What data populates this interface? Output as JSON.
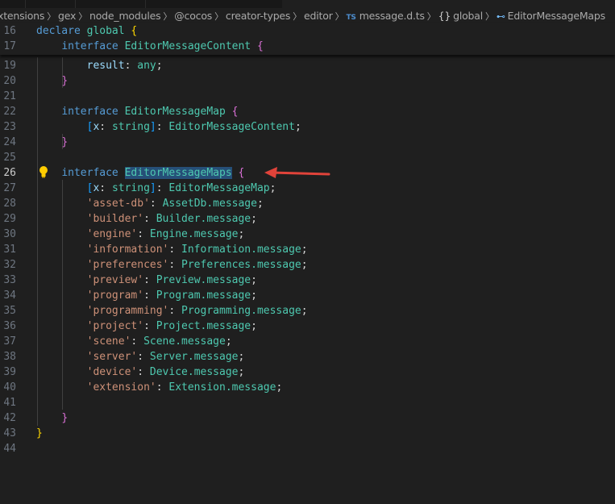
{
  "breadcrumb": {
    "items": [
      "xtensions",
      "gex",
      "node_modules",
      "@cocos",
      "creator-types",
      "editor"
    ],
    "file_icon": "TS",
    "file": "message.d.ts",
    "namespace_icon": "{}",
    "namespace": "global",
    "symbol_icon": "interface-symbol-icon",
    "symbol": "EditorMessageMaps"
  },
  "editor": {
    "active_line": 26,
    "sticky_lines": [
      {
        "n": "16",
        "tokens": [
          [
            "kw",
            "declare"
          ],
          [
            "pu",
            " "
          ],
          [
            "ty",
            "global"
          ],
          [
            "pu",
            " "
          ],
          [
            "b1",
            "{"
          ]
        ]
      },
      {
        "n": "17",
        "tokens": [
          [
            "pu",
            "    "
          ],
          [
            "kw",
            "interface"
          ],
          [
            "pu",
            " "
          ],
          [
            "ty",
            "EditorMessageContent"
          ],
          [
            "pu",
            " "
          ],
          [
            "b2",
            "{"
          ]
        ]
      }
    ],
    "lines": [
      {
        "n": "19",
        "tokens": [
          [
            "pu",
            "        "
          ],
          [
            "pr",
            "result"
          ],
          [
            "pu",
            ": "
          ],
          [
            "ty",
            "any"
          ],
          [
            "pu",
            ";"
          ]
        ]
      },
      {
        "n": "20",
        "tokens": [
          [
            "pu",
            "    "
          ],
          [
            "b2",
            "}"
          ]
        ]
      },
      {
        "n": "21",
        "tokens": []
      },
      {
        "n": "22",
        "tokens": [
          [
            "pu",
            "    "
          ],
          [
            "kw",
            "interface"
          ],
          [
            "pu",
            " "
          ],
          [
            "ty",
            "EditorMessageMap"
          ],
          [
            "pu",
            " "
          ],
          [
            "b2",
            "{"
          ]
        ]
      },
      {
        "n": "23",
        "tokens": [
          [
            "pu",
            "        "
          ],
          [
            "b3",
            "["
          ],
          [
            "pr",
            "x"
          ],
          [
            "pu",
            ": "
          ],
          [
            "ty",
            "string"
          ],
          [
            "b3",
            "]"
          ],
          [
            "pu",
            ": "
          ],
          [
            "ty",
            "EditorMessageContent"
          ],
          [
            "pu",
            ";"
          ]
        ]
      },
      {
        "n": "24",
        "tokens": [
          [
            "pu",
            "    "
          ],
          [
            "b2",
            "}"
          ]
        ]
      },
      {
        "n": "25",
        "tokens": []
      },
      {
        "n": "26",
        "tokens": [
          [
            "pu",
            "    "
          ],
          [
            "kw",
            "interface"
          ],
          [
            "pu",
            " "
          ],
          [
            "ty sel",
            "EditorMessageMaps"
          ],
          [
            "pu",
            " "
          ],
          [
            "b2",
            "{"
          ]
        ]
      },
      {
        "n": "27",
        "tokens": [
          [
            "pu",
            "        "
          ],
          [
            "b3",
            "["
          ],
          [
            "pr",
            "x"
          ],
          [
            "pu",
            ": "
          ],
          [
            "ty",
            "string"
          ],
          [
            "b3",
            "]"
          ],
          [
            "pu",
            ": "
          ],
          [
            "ty",
            "EditorMessageMap"
          ],
          [
            "pu",
            ";"
          ]
        ]
      },
      {
        "n": "28",
        "tokens": [
          [
            "pu",
            "        "
          ],
          [
            "st",
            "'asset-db'"
          ],
          [
            "pu",
            ": "
          ],
          [
            "ty",
            "AssetDb.message"
          ],
          [
            "pu",
            ";"
          ]
        ]
      },
      {
        "n": "29",
        "tokens": [
          [
            "pu",
            "        "
          ],
          [
            "st",
            "'builder'"
          ],
          [
            "pu",
            ": "
          ],
          [
            "ty",
            "Builder.message"
          ],
          [
            "pu",
            ";"
          ]
        ]
      },
      {
        "n": "30",
        "tokens": [
          [
            "pu",
            "        "
          ],
          [
            "st",
            "'engine'"
          ],
          [
            "pu",
            ": "
          ],
          [
            "ty",
            "Engine.message"
          ],
          [
            "pu",
            ";"
          ]
        ]
      },
      {
        "n": "31",
        "tokens": [
          [
            "pu",
            "        "
          ],
          [
            "st",
            "'information'"
          ],
          [
            "pu",
            ": "
          ],
          [
            "ty",
            "Information.message"
          ],
          [
            "pu",
            ";"
          ]
        ]
      },
      {
        "n": "32",
        "tokens": [
          [
            "pu",
            "        "
          ],
          [
            "st",
            "'preferences'"
          ],
          [
            "pu",
            ": "
          ],
          [
            "ty",
            "Preferences.message"
          ],
          [
            "pu",
            ";"
          ]
        ]
      },
      {
        "n": "33",
        "tokens": [
          [
            "pu",
            "        "
          ],
          [
            "st",
            "'preview'"
          ],
          [
            "pu",
            ": "
          ],
          [
            "ty",
            "Preview.message"
          ],
          [
            "pu",
            ";"
          ]
        ]
      },
      {
        "n": "34",
        "tokens": [
          [
            "pu",
            "        "
          ],
          [
            "st",
            "'program'"
          ],
          [
            "pu",
            ": "
          ],
          [
            "ty",
            "Program.message"
          ],
          [
            "pu",
            ";"
          ]
        ]
      },
      {
        "n": "35",
        "tokens": [
          [
            "pu",
            "        "
          ],
          [
            "st",
            "'programming'"
          ],
          [
            "pu",
            ": "
          ],
          [
            "ty",
            "Programming.message"
          ],
          [
            "pu",
            ";"
          ]
        ]
      },
      {
        "n": "36",
        "tokens": [
          [
            "pu",
            "        "
          ],
          [
            "st",
            "'project'"
          ],
          [
            "pu",
            ": "
          ],
          [
            "ty",
            "Project.message"
          ],
          [
            "pu",
            ";"
          ]
        ]
      },
      {
        "n": "37",
        "tokens": [
          [
            "pu",
            "        "
          ],
          [
            "st",
            "'scene'"
          ],
          [
            "pu",
            ": "
          ],
          [
            "ty",
            "Scene.message"
          ],
          [
            "pu",
            ";"
          ]
        ]
      },
      {
        "n": "38",
        "tokens": [
          [
            "pu",
            "        "
          ],
          [
            "st",
            "'server'"
          ],
          [
            "pu",
            ": "
          ],
          [
            "ty",
            "Server.message"
          ],
          [
            "pu",
            ";"
          ]
        ]
      },
      {
        "n": "39",
        "tokens": [
          [
            "pu",
            "        "
          ],
          [
            "st",
            "'device'"
          ],
          [
            "pu",
            ": "
          ],
          [
            "ty",
            "Device.message"
          ],
          [
            "pu",
            ";"
          ]
        ]
      },
      {
        "n": "40",
        "tokens": [
          [
            "pu",
            "        "
          ],
          [
            "st",
            "'extension'"
          ],
          [
            "pu",
            ": "
          ],
          [
            "ty",
            "Extension.message"
          ],
          [
            "pu",
            ";"
          ]
        ]
      },
      {
        "n": "41",
        "tokens": []
      },
      {
        "n": "42",
        "tokens": [
          [
            "pu",
            "    "
          ],
          [
            "b2",
            "}"
          ]
        ]
      },
      {
        "n": "43",
        "tokens": [
          [
            "b1",
            "}"
          ]
        ]
      },
      {
        "n": "44",
        "tokens": []
      }
    ]
  },
  "annotation": {
    "arrow_color": "#e0433a"
  }
}
